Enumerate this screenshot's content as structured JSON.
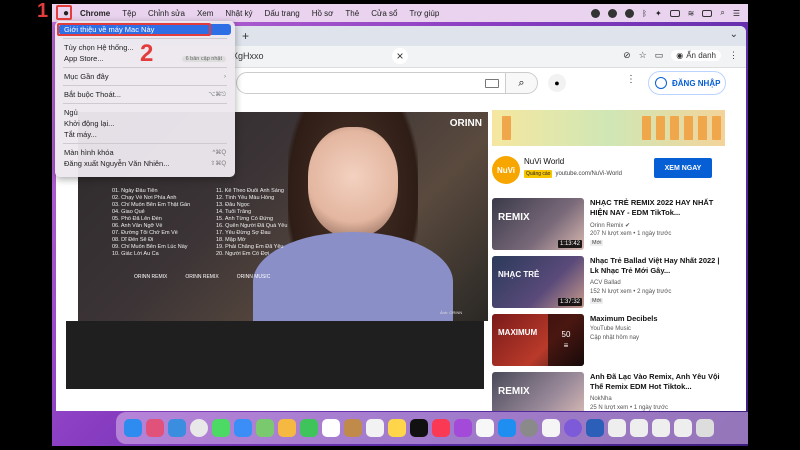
{
  "menubar": {
    "app": "Chrome",
    "items": [
      "Tệp",
      "Chỉnh sửa",
      "Xem",
      "Nhật ký",
      "Dấu trang",
      "Hồ sơ",
      "Thẻ",
      "Cửa sổ",
      "Trợ giúp"
    ]
  },
  "markers": {
    "step1": "1",
    "step2": "2"
  },
  "apple_menu": {
    "items": [
      {
        "label": "Giới thiệu về máy Mac Này",
        "selected": true
      },
      {
        "label": "Tùy chọn Hệ thống..."
      },
      {
        "label": "App Store...",
        "badge": "6 bản cập nhật"
      },
      {
        "label": "Mục Gần đây",
        "right": "›"
      },
      {
        "label": "Bắt buộc Thoát...",
        "right": "⌥⌘⎋"
      },
      {
        "label": "Ngủ"
      },
      {
        "label": "Khởi động lại..."
      },
      {
        "label": "Tắt máy..."
      },
      {
        "label": "Màn hình khóa",
        "right": "^⌘Q"
      },
      {
        "label": "Đăng xuất Nguyễn Văn Nhiên...",
        "right": "⇧⌘Q"
      }
    ]
  },
  "browser": {
    "url_fragment": "XgHxxo",
    "incognito_label": "Ẩn danh"
  },
  "youtube": {
    "login_label": "ĐĂNG NHẬP"
  },
  "video": {
    "brand": "ORINN",
    "tracks_left": [
      "01. Ngày Đầu Tiên",
      "02. Chạy Về Nơi Phía Anh",
      "03. Chỉ Muốn Bên Em Thật Gần",
      "04. Giao Quẻ",
      "05. Phố Đã Lên Đèn",
      "06. Anh Vẫn Ngỡ Về",
      "07. Đường Tôi Chở Em Về",
      "08. Dĩ Đến Sẽ Đi",
      "09. Chỉ Muốn Bên Em Lúc Này",
      "10. Giác Lời Âu Ca"
    ],
    "tracks_right": [
      "11. Kẻ Theo Đuổi Ánh Sáng",
      "12. Tình Yêu Màu Hồng",
      "13. Đâu Ngọc",
      "14. Tuổi Trăng",
      "15. Anh Từng Có Đứng",
      "16. Quên Người Đã Quá Yêu",
      "17. Yêu Đừng Sợ Đau",
      "18. Mập Mờ",
      "19. Phải Chẳng Em Đã Yêu",
      "20. Người Em Cố Đợi"
    ],
    "logos": [
      "ORINN REMIX",
      "ORINN REMIX",
      "ORINN MUSIC"
    ],
    "caption": "Ảnh: ORINN"
  },
  "ad": {
    "logo": "NuVi",
    "title": "NuVi World",
    "badge": "Quảng cáo",
    "url": "youtube.com/NuVi-World",
    "button": "XEM NGAY"
  },
  "recommendations": [
    {
      "title": "NHẠC TRẺ REMIX 2022 HAY NHẤT HIỆN NAY - EDM TikTok...",
      "channel": "Orinn Remix ✔",
      "meta": "207 N lượt xem • 1 ngày trước",
      "new": "Mới",
      "duration": "1:13:42",
      "thumb_label": "REMIX"
    },
    {
      "title": "Nhạc Trẻ Ballad Việt Hay Nhất 2022 | Lk Nhạc Trẻ Mới Gây...",
      "channel": "ACV Ballad",
      "meta": "152 N lượt xem • 2 ngày trước",
      "new": "Mới",
      "duration": "1:37:32",
      "thumb_label": "NHẠC TRẺ"
    },
    {
      "title": "Maximum Decibels",
      "channel": "YouTube Music",
      "meta": "Cập nhật hôm nay",
      "playlist_count": "50",
      "thumb_label": "MAXIMUM"
    },
    {
      "title": "Anh Đã Lạc Vào Remix, Anh Yêu Vội Thế Remix EDM Hot Tiktok...",
      "channel": "NokNha",
      "meta": "25 N lượt xem • 1 ngày trước",
      "thumb_label": "REMIX"
    }
  ]
}
